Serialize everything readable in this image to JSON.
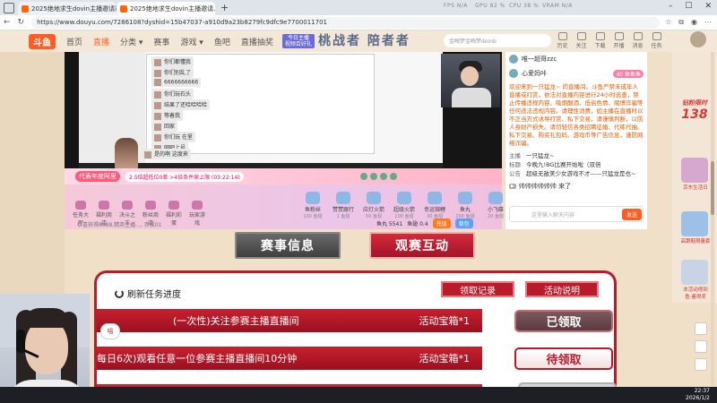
{
  "browser": {
    "tabs": [
      {
        "label": "2025绝地求生dovin主播邀请赛_为..."
      },
      {
        "label": "2025绝地求生dovin主播邀请..."
      }
    ],
    "perf": {
      "fps": "FPS N/A",
      "gpu": "GPU 82 %",
      "cpu": "CPU 38 %",
      "vram": "VRAM N/A"
    },
    "url": "https://www.douyu.com/7286108?dyshid=15b47037-a910d9a23b8279fc9dfc9e7700011701"
  },
  "site": {
    "logo": "斗鱼",
    "nav": [
      "首页",
      "直播",
      "分类 ▾",
      "赛事",
      "游戏 ▾",
      "鱼吧",
      "直播抽奖"
    ],
    "recommend": "今日主播 视频百好礼",
    "banner": "桃战者 陪者者",
    "search_placeholder": "金晦梦金晦梦doinb",
    "top_icons": [
      "历史",
      "关注",
      "下载",
      "开播",
      "消息",
      "任务"
    ]
  },
  "video": {
    "chat_lines": [
      "你们都懂我",
      "你们别乱了",
      "6666666666",
      "你们玩石头",
      "结果了还哈哈哈哈",
      "等着我",
      "回家",
      "你们玩 在里",
      "网吧上号",
      "是的啊 这度来"
    ],
    "progress_label": "代表年度阿里",
    "progress_pill": "2.5倍超低位0差 >4倍条件家上限 (03:22:14)"
  },
  "gifts": {
    "left": [
      "任务大厅",
      "福利商店",
      "决斗之王",
      "粉丝商店",
      "福利彩蛋",
      "玩家游戏"
    ],
    "right": [
      {
        "name": "鱼粉丝",
        "sub": "100 鱼翅"
      },
      {
        "name": "赞赞跟行",
        "sub": "1 鱼翅"
      },
      {
        "name": "应灯火箭",
        "sub": "50 鱼翅"
      },
      {
        "name": "超级火箭",
        "sub": "100 鱼翅"
      },
      {
        "name": "幸运锦鲤",
        "sub": "30 鱼翅"
      },
      {
        "name": "鱼丸",
        "sub": "200 鱼翅"
      },
      {
        "name": "小飞碟",
        "sub": "20 鱼翅"
      }
    ],
    "ticker": "恭喜获得8888,精英主播..., 赤狐01",
    "fish": "鱼丸 5541",
    "fin": "鱼翅 0.4",
    "charge": "充值",
    "bag": "背包"
  },
  "chat": {
    "users": [
      {
        "name": "唯一超哥zzc",
        "level": ""
      },
      {
        "name": "心爱妈咔",
        "level": "40 鱼鱼鱼"
      }
    ],
    "notice": "欢迎来到一只猛龙~ 的直播间。斗鱼严禁未成年人直播或打赏，依法对直播内容进行24小时巡查，禁止传播违规内容、吸烟酗酒、低俗色情、赌博诈骗等任何违法违规内容。请理性消费，如主播在直播时以不正当方式诱导打赏、私下交易，请谨慎判断，以防人身财产损失。请勿轻信各类招聘征婚、代练代抽、私下交易、购买礼包码、游戏币等广告信息，谨防网络诈骗。",
    "room": [
      {
        "k": "主播",
        "v": "一只猛龙~"
      },
      {
        "k": "标题",
        "v": "今晚九!BG比赛开始啦（双倍"
      },
      {
        "k": "公告",
        "v": "超级无敌美少女游戏不才——只猛龙是也~"
      }
    ],
    "message": "帅帅帅帅帅帅 来了",
    "input_placeholder": "这里输入聊天内容",
    "send": "发送"
  },
  "ads": {
    "promo_title": "钻粉限时",
    "promo_num": "138",
    "labels": [
      "京东生活日",
      "高跟鞋限量套",
      "本活动得到",
      "鱼·鉴得奖"
    ]
  },
  "event": {
    "tab_1": "赛事信息",
    "tab_2": "观赛互动",
    "refresh": "刷新任务进度",
    "claim_record": "领取记录",
    "activity_desc": "活动说明",
    "tasks": [
      {
        "name": "(一次性)关注参赛主播直播间",
        "reward": "活动宝箱*1",
        "button": "已领取",
        "state": "done"
      },
      {
        "name": "每日6次)观看任意一位参赛主播直播间10分钟",
        "reward": "活动宝箱*1",
        "button": "待领取",
        "state": "todo"
      }
    ]
  },
  "overlay": {
    "cat": "喵"
  },
  "taskbar": {
    "time": "22:37",
    "date": "2026/1/2"
  },
  "colors": {
    "brand": "#ff5d23",
    "event_red": "#b81b2a"
  }
}
